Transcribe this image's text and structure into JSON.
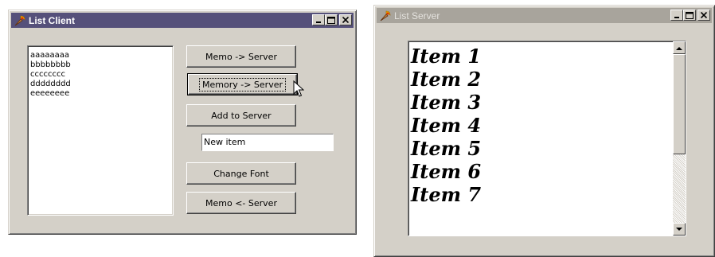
{
  "client": {
    "title": "List Client",
    "memo_lines": [
      "aaaaaaaa",
      "bbbbbbbb",
      "cccccccc",
      "dddddddd",
      "eeeeeeee"
    ],
    "buttons": {
      "memo_to_server": "Memo -> Server",
      "memory_to_server": "Memory -> Server",
      "add_to_server": "Add to Server",
      "change_font": "Change Font",
      "memo_from_server": "Memo <- Server"
    },
    "new_item_value": "New item"
  },
  "server": {
    "title": "List Server",
    "items": [
      "Item 1",
      "Item 2",
      "Item 3",
      "Item 4",
      "Item 5",
      "Item 6",
      "Item 7"
    ]
  },
  "colors": {
    "active_title": "#55507a",
    "inactive_title": "#a8a49c",
    "face": "#d4d0c8"
  },
  "icons": {
    "app_icon": "delphi-torch-icon",
    "minimize": "minimize-icon",
    "maximize": "maximize-icon",
    "close": "close-icon",
    "cursor": "mouse-pointer-icon"
  }
}
